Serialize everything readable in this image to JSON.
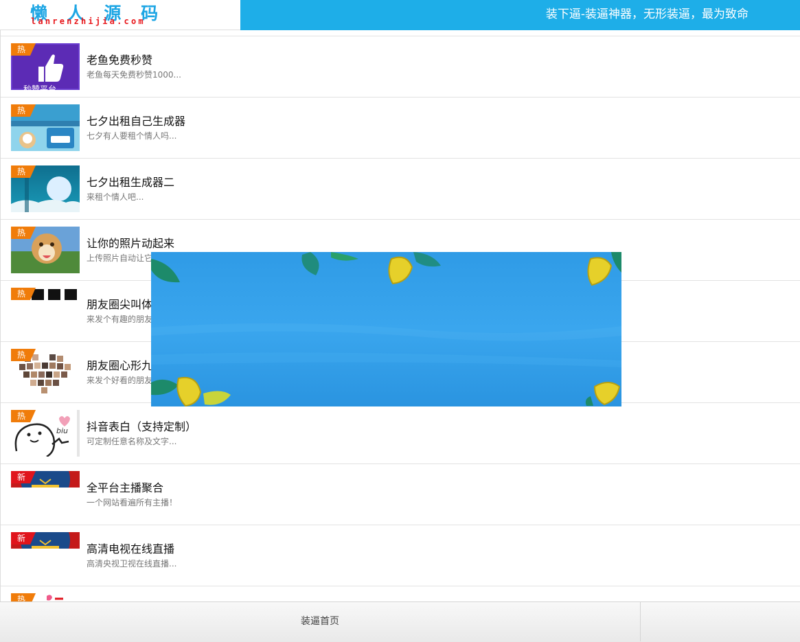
{
  "header": {
    "logo_text": "懒 人 源 码",
    "logo_subtext": "lanrenzhijia.com",
    "slogan": "装下逼-装逼神器，无形装逼，最为致命"
  },
  "colors": {
    "header_bg": "#1eaee8",
    "badge_hot": "#f07c0a",
    "badge_new": "#e0141c"
  },
  "items": [
    {
      "badge": "热",
      "badge_type": "hot",
      "thumb": "thumbs-up-promo",
      "title": "老鱼免费秒赞",
      "desc": "老鱼每天免费秒赞1000..."
    },
    {
      "badge": "热",
      "badge_type": "hot",
      "thumb": "qixi-rent-poster",
      "title": "七夕出租自己生成器",
      "desc": "七夕有人要租个情人吗..."
    },
    {
      "badge": "热",
      "badge_type": "hot",
      "thumb": "qixi-moon-poster",
      "title": "七夕出租生成器二",
      "desc": "来租个情人吧..."
    },
    {
      "badge": "热",
      "badge_type": "hot",
      "thumb": "smiling-dog-photo",
      "title": "让你的照片动起来",
      "desc": "上传照片自动让它"
    },
    {
      "badge": "热",
      "badge_type": "hot",
      "thumb": "black-text-banner",
      "title": "朋友圈尖叫体",
      "desc": "来发个有趣的朋友"
    },
    {
      "badge": "热",
      "badge_type": "hot",
      "thumb": "heart-photo-collage",
      "title": "朋友圈心形九",
      "desc": "来发个好看的朋友"
    },
    {
      "badge": "热",
      "badge_type": "hot",
      "thumb": "biu-cartoon",
      "title": "抖音表白（支持定制）",
      "desc": "可定制任意名称及文字..."
    },
    {
      "badge": "新",
      "badge_type": "new",
      "thumb": "stage-curtain",
      "title": "全平台主播聚合",
      "desc": "一个网站看遍所有主播！"
    },
    {
      "badge": "新",
      "badge_type": "new",
      "thumb": "stage-curtain",
      "title": "高清电视在线直播",
      "desc": "高清央视卫视在线直播..."
    },
    {
      "badge": "热",
      "badge_type": "hot",
      "thumb": "partial-thumb",
      "title": "",
      "desc": ""
    }
  ],
  "overlay": {
    "name": "blue-leaf-banner"
  },
  "footer": {
    "home_label": "装逼首页"
  }
}
